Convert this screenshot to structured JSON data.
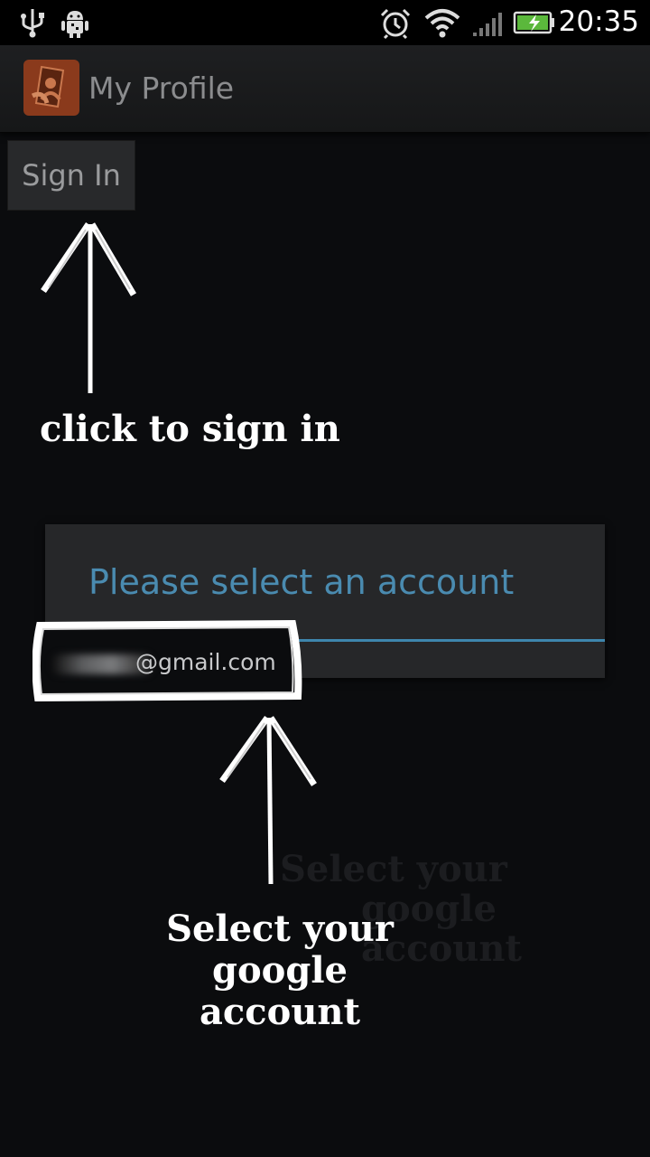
{
  "status_bar": {
    "time": "20:35",
    "icons": [
      "usb-icon",
      "android-debug-icon",
      "alarm-icon",
      "wifi-icon",
      "signal-icon",
      "battery-charging-icon"
    ]
  },
  "action_bar": {
    "title": "My Profile",
    "logo_icon": "profile-app-icon"
  },
  "main": {
    "sign_in_label": "Sign In"
  },
  "dialog": {
    "title": "Please select an account",
    "accounts": [
      {
        "email_visible": "@gmail.com"
      }
    ]
  },
  "annotations": {
    "sign_in_hint": "click to sign in",
    "account_hint_line1": "Select your",
    "account_hint_line2": "google account"
  },
  "colors": {
    "dialog_title": "#4a8bb0",
    "divider": "#3e86ad",
    "app_logo": "#8a3a1c"
  }
}
